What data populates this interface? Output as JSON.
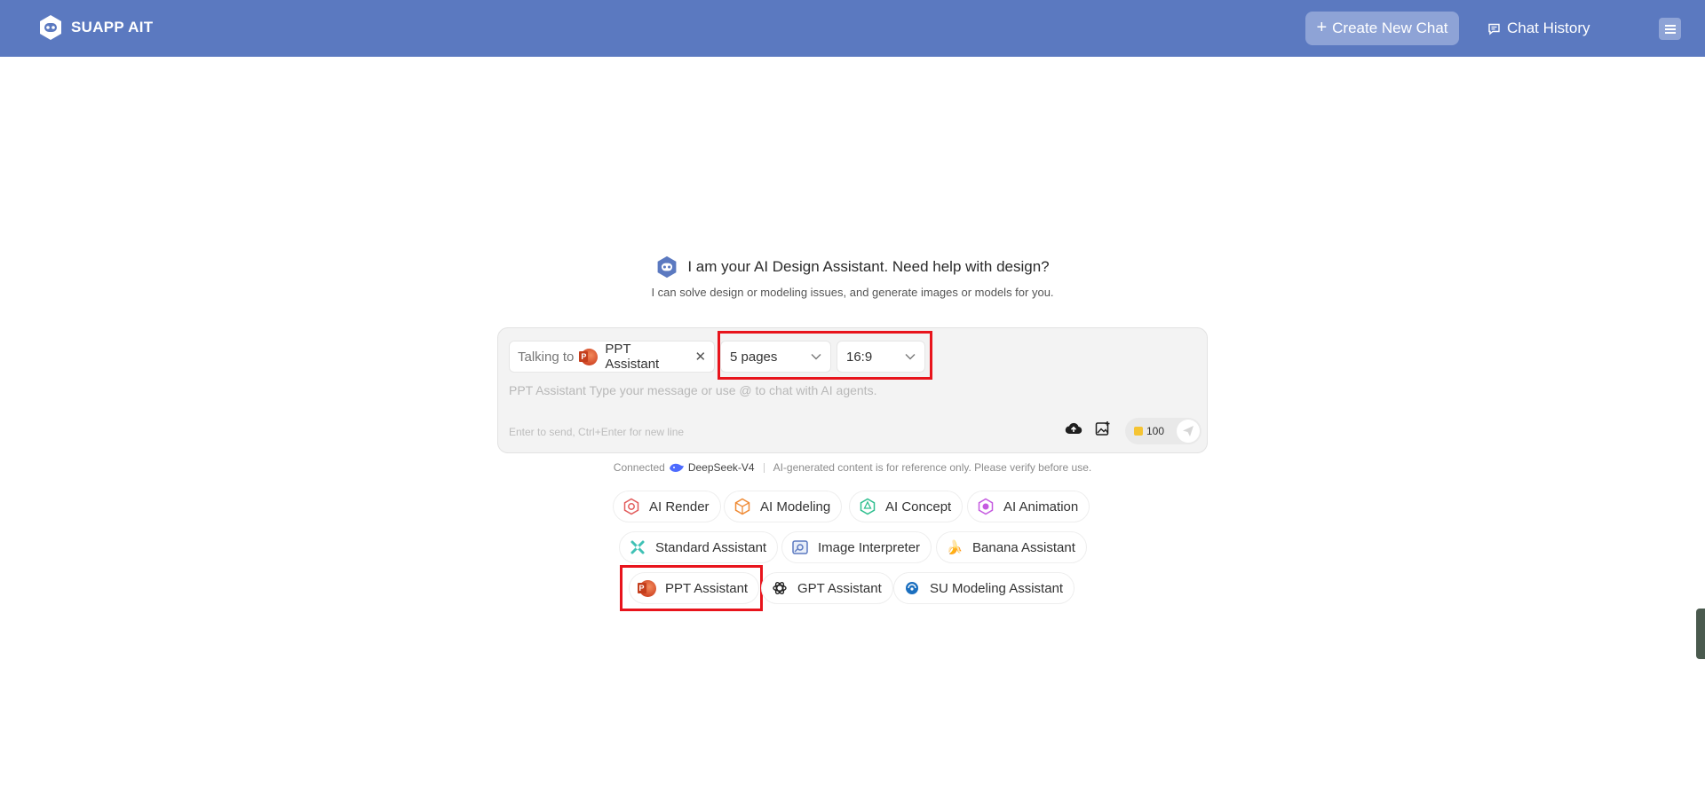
{
  "header": {
    "brand": "SUAPP AIT",
    "create_label": "Create New Chat",
    "history_label": "Chat History"
  },
  "greeting": {
    "title": "I am your AI Design Assistant. Need help with design?",
    "subtitle": "I can solve design or modeling issues, and generate images or models for you."
  },
  "composer": {
    "talking_label": "Talking to",
    "agent_name": "PPT Assistant",
    "pages_value": "5 pages",
    "ratio_value": "16:9",
    "placeholder": "PPT Assistant Type your message or use @ to chat with AI agents.",
    "hint": "Enter to send, Ctrl+Enter for new line",
    "credits": "100"
  },
  "status": {
    "connected_label": "Connected",
    "model": "DeepSeek-V4",
    "disclaimer": "AI-generated content is for reference only. Please verify before use."
  },
  "agents": {
    "row1": [
      "AI Render",
      "AI Modeling",
      "AI Concept",
      "AI Animation"
    ],
    "row2": [
      "Standard Assistant",
      "Image Interpreter",
      "Banana Assistant"
    ],
    "row3": [
      "PPT Assistant",
      "GPT Assistant",
      "SU Modeling Assistant"
    ]
  },
  "colors": {
    "header_bg": "#5b79c0",
    "highlight": "#e8141c"
  }
}
